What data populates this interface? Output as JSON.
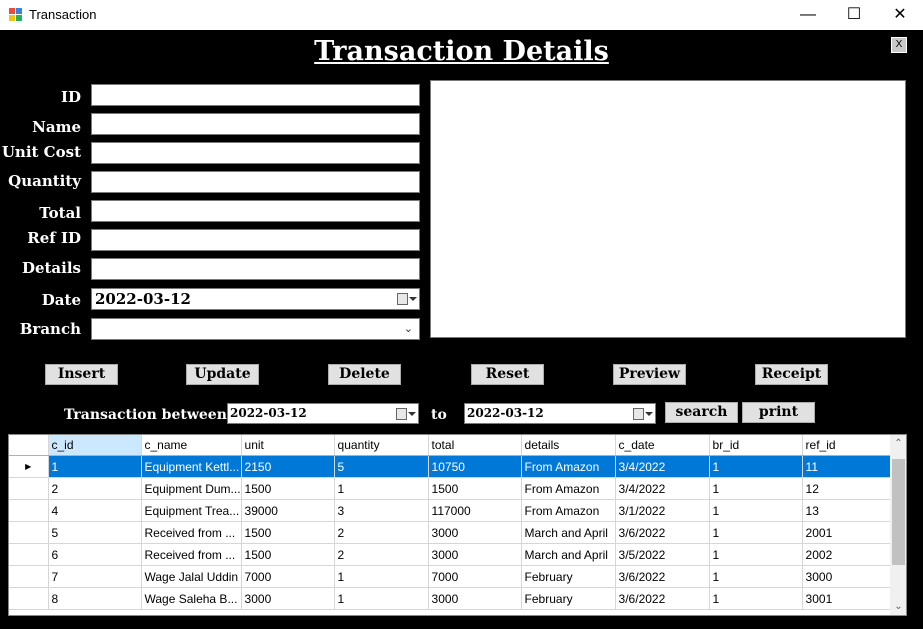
{
  "window": {
    "title": "Transaction",
    "minimize": "—",
    "maximize": "☐",
    "close": "✕"
  },
  "heading": "Transaction Details",
  "close_small": "X",
  "form": {
    "id": {
      "label": "ID",
      "value": ""
    },
    "name": {
      "label": "Name",
      "value": ""
    },
    "unit_cost": {
      "label": "Unit Cost",
      "value": ""
    },
    "quantity": {
      "label": "Quantity",
      "value": ""
    },
    "total": {
      "label": "Total",
      "value": ""
    },
    "ref_id": {
      "label": "Ref ID",
      "value": ""
    },
    "details": {
      "label": "Details",
      "value": ""
    },
    "date": {
      "label": "Date",
      "value": "2022-03-12"
    },
    "branch": {
      "label": "Branch",
      "value": ""
    }
  },
  "buttons": {
    "insert": "Insert",
    "update": "Update",
    "delete": "Delete",
    "reset": "Reset",
    "preview": "Preview",
    "receipt": "Receipt"
  },
  "search": {
    "label": "Transaction between",
    "from": "2022-03-12",
    "to_label": "to",
    "to": "2022-03-12",
    "search_button": "search",
    "print_button": "print"
  },
  "grid": {
    "columns": [
      "c_id",
      "c_name",
      "unit",
      "quantity",
      "total",
      "details",
      "c_date",
      "br_id",
      "ref_id"
    ],
    "rows": [
      [
        "1",
        "Equipment Kettl...",
        "2150",
        "5",
        "10750",
        "From Amazon",
        "3/4/2022",
        "1",
        "11"
      ],
      [
        "2",
        "Equipment Dum...",
        "1500",
        "1",
        "1500",
        "From Amazon",
        "3/4/2022",
        "1",
        "12"
      ],
      [
        "4",
        "Equipment Trea...",
        "39000",
        "3",
        "117000",
        "From Amazon",
        "3/1/2022",
        "1",
        "13"
      ],
      [
        "5",
        "Received from ...",
        "1500",
        "2",
        "3000",
        "March and April",
        "3/6/2022",
        "1",
        "2001"
      ],
      [
        "6",
        "Received from ...",
        "1500",
        "2",
        "3000",
        "March and April",
        "3/5/2022",
        "1",
        "2002"
      ],
      [
        "7",
        "Wage Jalal Uddin",
        "7000",
        "1",
        "7000",
        "February",
        "3/6/2022",
        "1",
        "3000"
      ],
      [
        "8",
        "Wage Saleha B...",
        "3000",
        "1",
        "3000",
        "February",
        "3/6/2022",
        "1",
        "3001"
      ]
    ],
    "selected_row": 0
  }
}
